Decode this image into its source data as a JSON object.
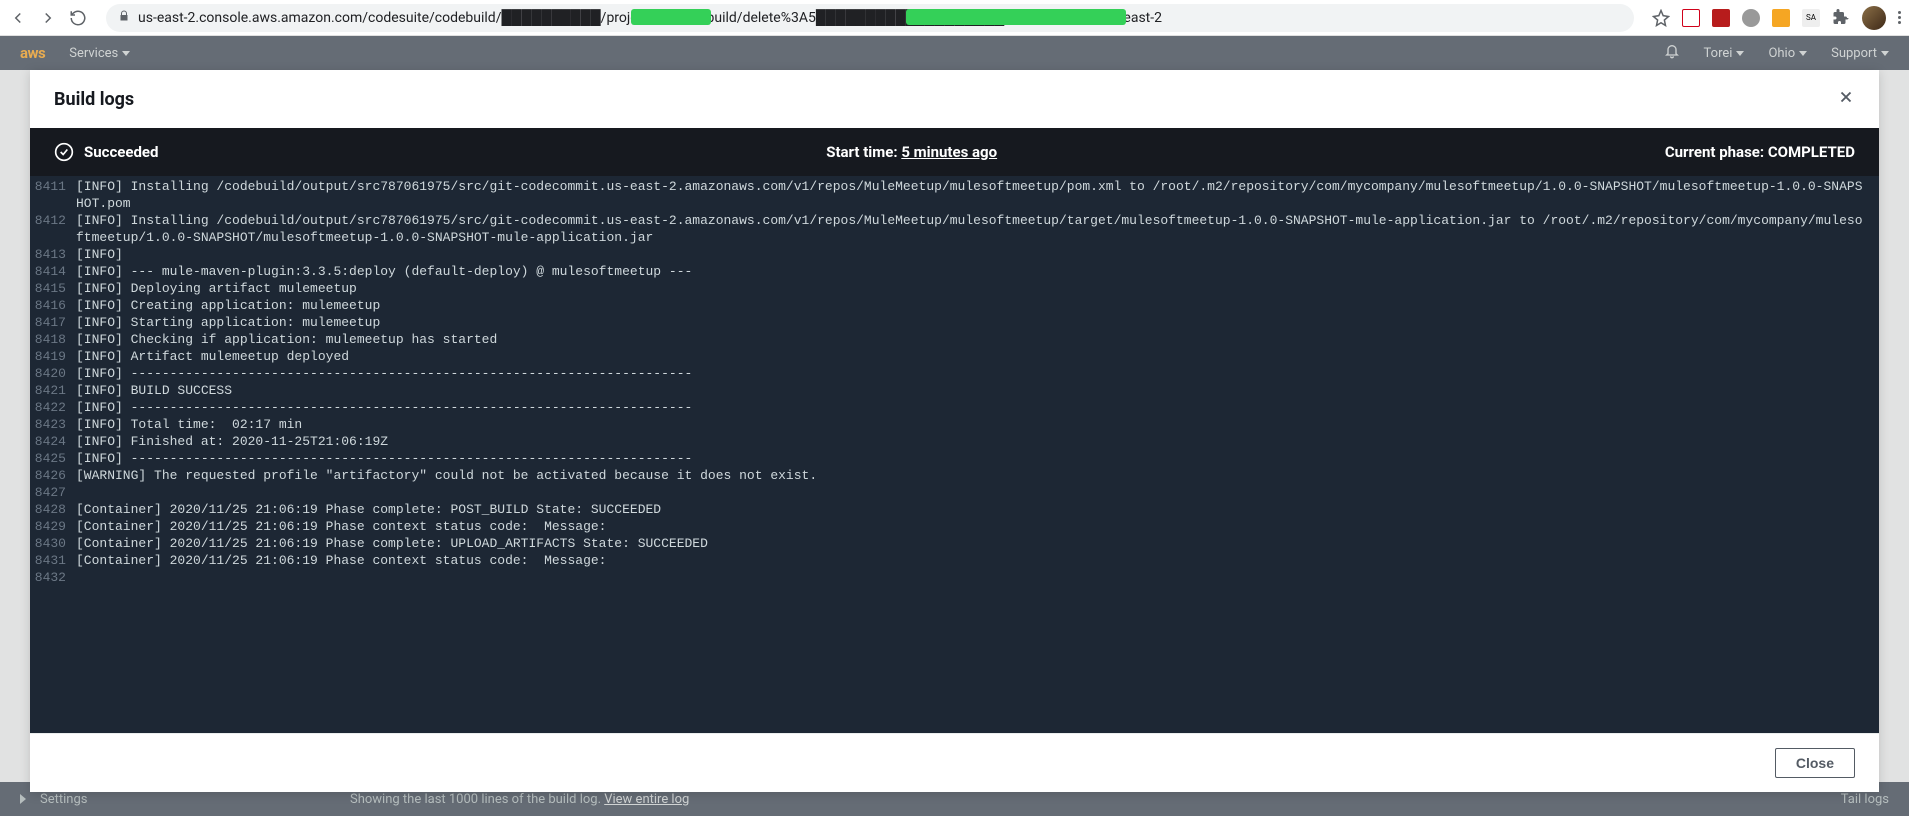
{
  "browser": {
    "url": "us-east-2.console.aws.amazon.com/codesuite/codebuild/██████████/projects/delete/build/delete%3A5███████████████████0ad975?region=us-east-2"
  },
  "aws_header": {
    "logo": "aws",
    "services": "Services",
    "user": "Torei",
    "region": "Ohio",
    "support": "Support"
  },
  "modal": {
    "title": "Build logs",
    "close_label": "Close"
  },
  "status": {
    "state": "Succeeded",
    "start_label": "Start time:",
    "start_value": "5 minutes ago",
    "phase_label": "Current phase:",
    "phase_value": "COMPLETED"
  },
  "logs": [
    {
      "no": "8411",
      "text": "[INFO] Installing /codebuild/output/src787061975/src/git-codecommit.us-east-2.amazonaws.com/v1/repos/MuleMeetup/mulesoftmeetup/pom.xml to /root/.m2/repository/com/mycompany/mulesoftmeetup/1.0.0-SNAPSHOT/mulesoftmeetup-1.0.0-SNAPSHOT.pom"
    },
    {
      "no": "8412",
      "text": "[INFO] Installing /codebuild/output/src787061975/src/git-codecommit.us-east-2.amazonaws.com/v1/repos/MuleMeetup/mulesoftmeetup/target/mulesoftmeetup-1.0.0-SNAPSHOT-mule-application.jar to /root/.m2/repository/com/mycompany/mulesoftmeetup/1.0.0-SNAPSHOT/mulesoftmeetup-1.0.0-SNAPSHOT-mule-application.jar"
    },
    {
      "no": "8413",
      "text": "[INFO]"
    },
    {
      "no": "8414",
      "text": "[INFO] --- mule-maven-plugin:3.3.5:deploy (default-deploy) @ mulesoftmeetup ---"
    },
    {
      "no": "8415",
      "text": "[INFO] Deploying artifact mulemeetup"
    },
    {
      "no": "8416",
      "text": "[INFO] Creating application: mulemeetup"
    },
    {
      "no": "8417",
      "text": "[INFO] Starting application: mulemeetup"
    },
    {
      "no": "8418",
      "text": "[INFO] Checking if application: mulemeetup has started"
    },
    {
      "no": "8419",
      "text": "[INFO] Artifact mulemeetup deployed"
    },
    {
      "no": "8420",
      "text": "[INFO] ------------------------------------------------------------------------"
    },
    {
      "no": "8421",
      "text": "[INFO] BUILD SUCCESS"
    },
    {
      "no": "8422",
      "text": "[INFO] ------------------------------------------------------------------------"
    },
    {
      "no": "8423",
      "text": "[INFO] Total time:  02:17 min"
    },
    {
      "no": "8424",
      "text": "[INFO] Finished at: 2020-11-25T21:06:19Z"
    },
    {
      "no": "8425",
      "text": "[INFO] ------------------------------------------------------------------------"
    },
    {
      "no": "8426",
      "text": "[WARNING] The requested profile \"artifactory\" could not be activated because it does not exist."
    },
    {
      "no": "8427",
      "text": ""
    },
    {
      "no": "8428",
      "text": "[Container] 2020/11/25 21:06:19 Phase complete: POST_BUILD State: SUCCEEDED"
    },
    {
      "no": "8429",
      "text": "[Container] 2020/11/25 21:06:19 Phase context status code:  Message: "
    },
    {
      "no": "8430",
      "text": "[Container] 2020/11/25 21:06:19 Phase complete: UPLOAD_ARTIFACTS State: SUCCEEDED"
    },
    {
      "no": "8431",
      "text": "[Container] 2020/11/25 21:06:19 Phase context status code:  Message: "
    },
    {
      "no": "8432",
      "text": ""
    }
  ],
  "bottom_strip": {
    "settings": "Settings",
    "showing": "Showing the last 1000 lines of the build log. ",
    "view_entire": "View entire log",
    "tail": "Tail logs"
  }
}
